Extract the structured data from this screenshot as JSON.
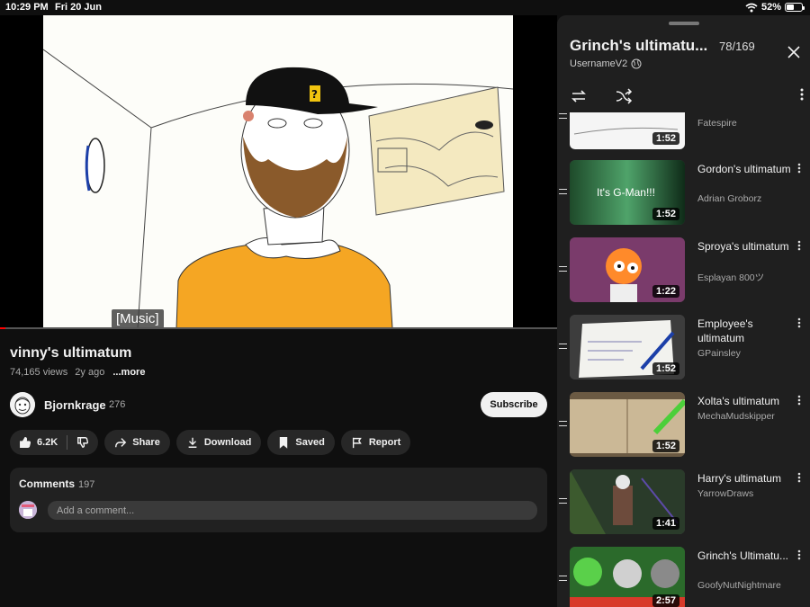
{
  "status": {
    "time": "10:29 PM",
    "date": "Fri 20 Jun",
    "battery": "52%",
    "battery_level": 0.52
  },
  "video": {
    "caption": "[Music]",
    "progress": 0.01,
    "title": "vinny's ultimatum",
    "views": "74,165 views",
    "age": "2y ago",
    "more": "...more"
  },
  "channel": {
    "name": "Bjornkrage",
    "subs": "276",
    "subscribe_label": "Subscribe"
  },
  "actions": {
    "likes": "6.2K",
    "share": "Share",
    "download": "Download",
    "saved": "Saved",
    "report": "Report"
  },
  "comments": {
    "title": "Comments",
    "count": "197",
    "placeholder": "Add a comment..."
  },
  "playlist": {
    "title": "Grinch's ultimatu...",
    "position": "78/169",
    "owner": "UsernameV2",
    "items": [
      {
        "title": "",
        "channel": "Fatespire",
        "duration": "1:52"
      },
      {
        "title": "Gordon's ultimatum",
        "channel": "Adrian Groborz",
        "duration": "1:52",
        "thumb_text": "It's G-Man!!!"
      },
      {
        "title": "Sproya's ultimatum",
        "channel": "Esplayan 800ツ",
        "duration": "1:22"
      },
      {
        "title": "Employee's ultimatum",
        "channel": "GPainsley",
        "duration": "1:52"
      },
      {
        "title": "Xolta's ultimatum",
        "channel": "MechaMudskipper",
        "duration": "1:52"
      },
      {
        "title": "Harry's ultimatum",
        "channel": "YarrowDraws",
        "duration": "1:41"
      },
      {
        "title": "Grinch's Ultimatu...",
        "channel": "GoofyNutNightmare",
        "duration": "2:57"
      }
    ]
  }
}
